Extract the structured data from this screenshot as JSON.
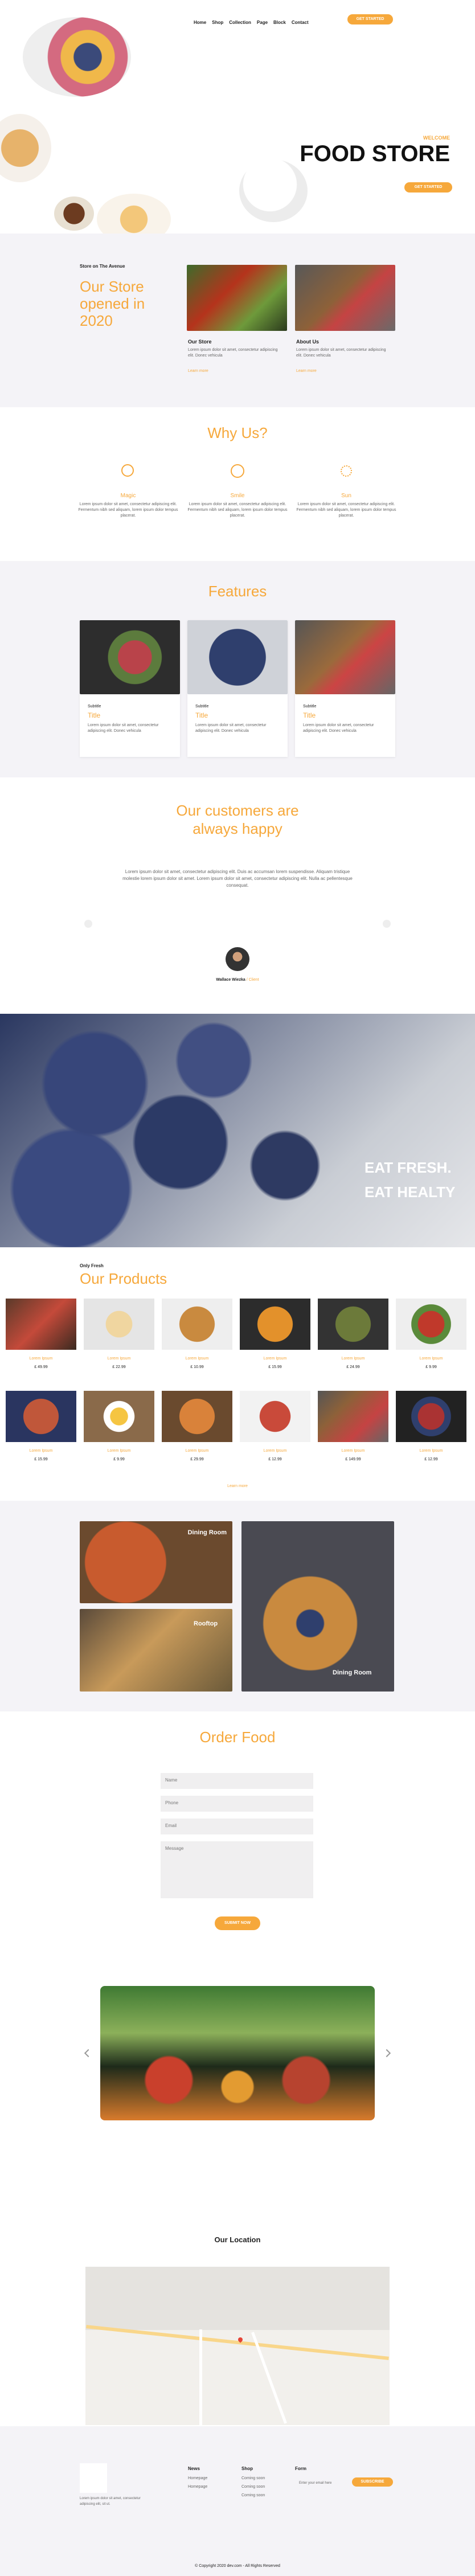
{
  "nav": {
    "items": [
      "Home",
      "Shop",
      "Collection",
      "Page",
      "Block",
      "Contact"
    ],
    "cta": "GET STARTED"
  },
  "hero": {
    "welcome": "WELCOME",
    "title": "FOOD STORE",
    "cta": "GET STARTED"
  },
  "store": {
    "eyebrow": "Store on The Avenue",
    "heading": "Our Store opened in 2020",
    "cards": [
      {
        "title": "Our Store",
        "text": "Lorem ipsum dolor sit amet, consectetur adipiscing elit. Donec vehicula",
        "link": "Learn more"
      },
      {
        "title": "About Us",
        "text": "Lorem ipsum dolor sit amet, consectetur adipiscing elit. Donec vehicula",
        "link": "Learn more"
      }
    ]
  },
  "why": {
    "heading": "Why Us?",
    "items": [
      {
        "icon": "magic-wand-icon",
        "title": "Magic",
        "text": "Lorem ipsum dolor sit amet, consectetur adipiscing elit. Fermentum nibh sed aliquam, lorem ipsum dolor tempus placerat."
      },
      {
        "icon": "smile-icon",
        "title": "Smile",
        "text": "Lorem ipsum dolor sit amet, consectetur adipiscing elit. Fermentum nibh sed aliquam, lorem ipsum dolor tempus placerat."
      },
      {
        "icon": "sun-icon",
        "title": "Sun",
        "text": "Lorem ipsum dolor sit amet, consectetur adipiscing elit. Fermentum nibh sed aliquam, lorem ipsum dolor tempus placerat."
      }
    ]
  },
  "features": {
    "heading": "Features",
    "cards": [
      {
        "label": "Subtitle",
        "title": "Title",
        "text": "Lorem ipsum dolor sit amet, consectetur adipiscing elit. Donec vehicula"
      },
      {
        "label": "Subtitle",
        "title": "Title",
        "text": "Lorem ipsum dolor sit amet, consectetur adipiscing elit. Donec vehicula"
      },
      {
        "label": "Subtitle",
        "title": "Title",
        "text": "Lorem ipsum dolor sit amet, consectetur adipiscing elit. Donec vehicula"
      }
    ]
  },
  "testimonial": {
    "heading": "Our customers are always happy",
    "quote": "Lorem ipsum dolor sit amet, consectetur adipiscing elit. Duis ac accumsan lorem suspendisse. Aliquam tristique molestie lorem ipsum dolor sit amet. Lorem ipsum dolor sit amet, consectetur adipiscing elit. Nulla ac pellentesque consequat.",
    "name": "Wallace Wiezka",
    "role": "/ Client"
  },
  "banner": {
    "line1": "EAT FRESH.",
    "line2": "EAT HEALTY"
  },
  "products": {
    "eyebrow": "Only Fresh",
    "heading": "Our Products",
    "items": [
      {
        "name": "Lorem Ipsum",
        "price": "£ 49.99"
      },
      {
        "name": "Lorem Ipsum",
        "price": "£ 22.99"
      },
      {
        "name": "Lorem Ipsum",
        "price": "£ 10.99"
      },
      {
        "name": "Lorem Ipsum",
        "price": "£ 15.99"
      },
      {
        "name": "Lorem Ipsum",
        "price": "£ 24.99"
      },
      {
        "name": "Lorem Ipsum",
        "price": "£ 9.99"
      },
      {
        "name": "Lorem Ipsum",
        "price": "£ 15.99"
      },
      {
        "name": "Lorem Ipsum",
        "price": "£ 9.99"
      },
      {
        "name": "Lorem Ipsum",
        "price": "£ 29.99"
      },
      {
        "name": "Lorem Ipsum",
        "price": "£ 12.99"
      },
      {
        "name": "Lorem Ipsum",
        "price": "£ 149.99"
      },
      {
        "name": "Lorem Ipsum",
        "price": "£ 12.99"
      }
    ],
    "more": "Learn more"
  },
  "gallery": {
    "labels": [
      "Dining Room",
      "Rooftop",
      "Dining Room"
    ]
  },
  "order": {
    "heading": "Order Food",
    "name": "Name",
    "phone": "Phone",
    "email": "Email",
    "message": "Message",
    "submit": "SUBMIT NOW"
  },
  "location": {
    "heading": "Our Location"
  },
  "footer": {
    "about": "Lorem ipsum dolor sit amet, consectetur adipiscing elit, sit ut.",
    "cols": [
      {
        "title": "News",
        "items": [
          "Homepage",
          "Homepage"
        ]
      },
      {
        "title": "Shop",
        "items": [
          "Coming soon",
          "Coming soon",
          "Coming soon"
        ]
      },
      {
        "title": "Form",
        "placeholder": "Enter your email here",
        "btn": "SUBSCRIBE"
      }
    ],
    "copyright": "© Copyright 2020 dev.com - All Rights Reserved"
  },
  "colors": {
    "accent": "#f6a83b",
    "section_bg": "#f4f3f7"
  }
}
